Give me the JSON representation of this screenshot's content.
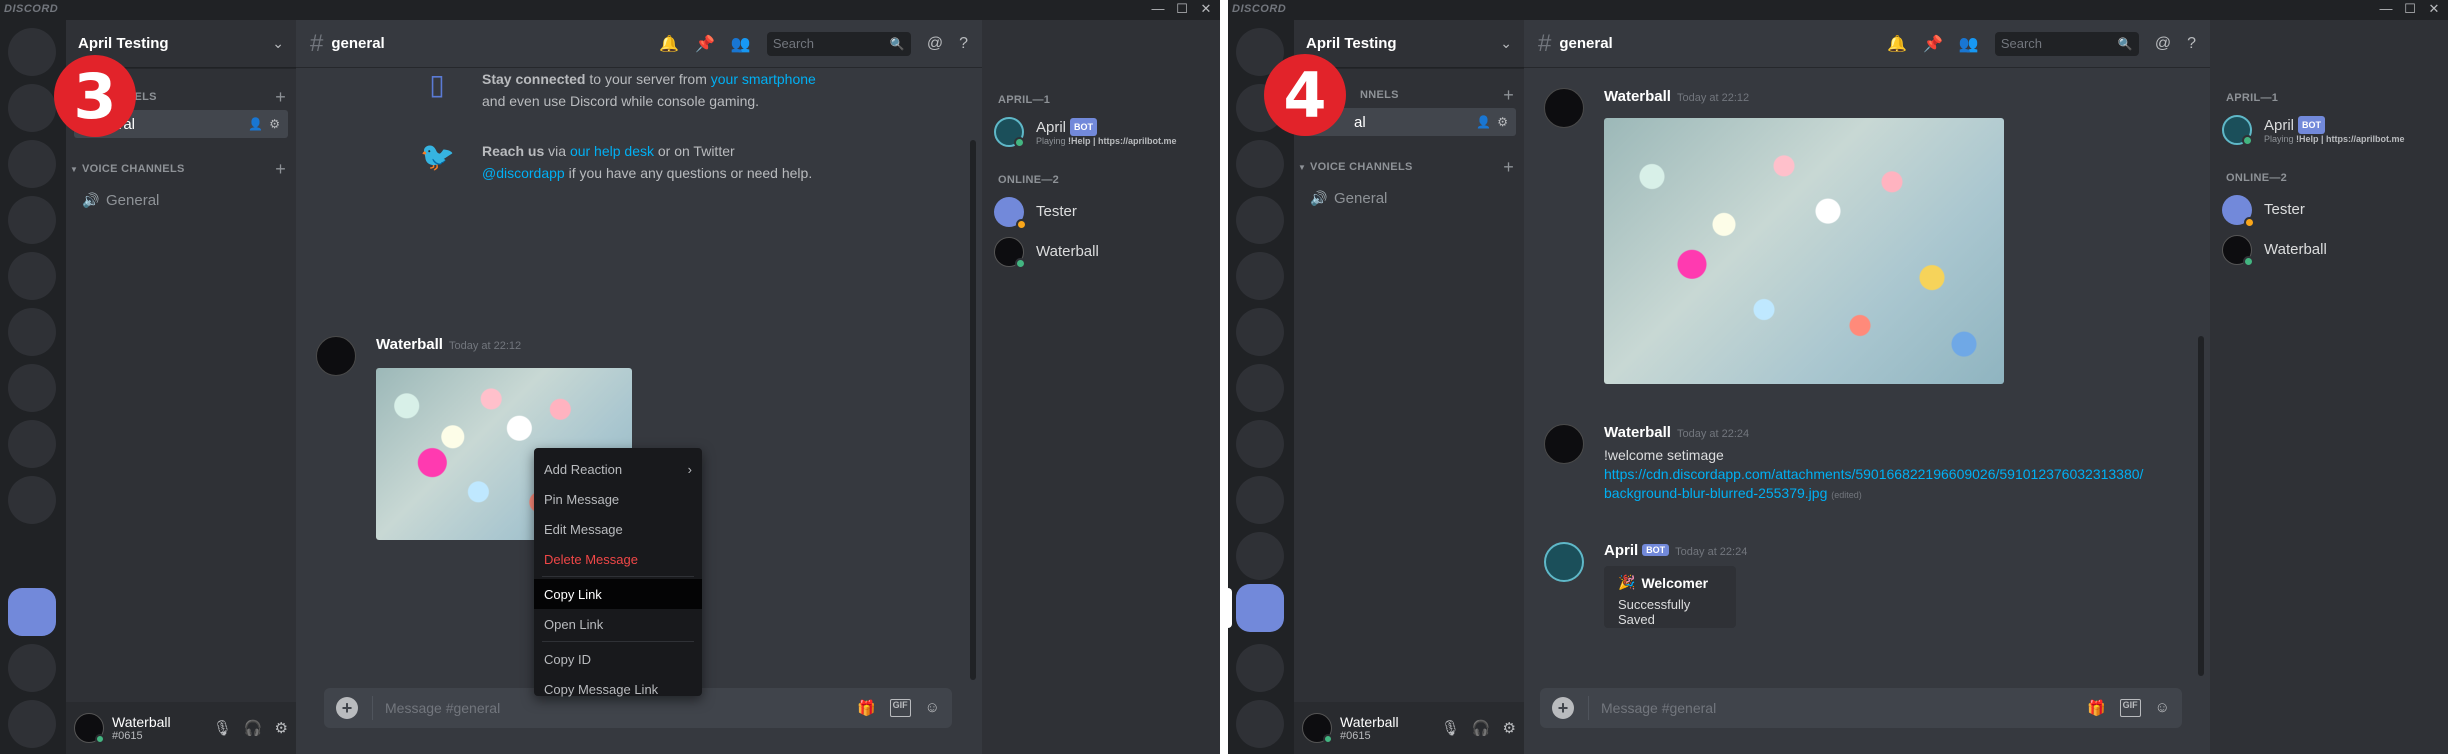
{
  "app": {
    "wordmark": "DISCORD",
    "win_min": "—",
    "win_max": "☐",
    "win_close": "✕"
  },
  "panels": [
    {
      "step": "3",
      "server_name": "April Testing",
      "text_category": "TEXT CHANNELS",
      "text_category_visible": "NNELS",
      "selected_channel": "general",
      "selected_channel_visible": "eral",
      "voice_category": "VOICE CHANNELS",
      "voice_channel": "General",
      "user": {
        "name": "Waterball",
        "discriminator": "#0615"
      },
      "header": {
        "channel": "general",
        "search_placeholder": "Search"
      },
      "welcome": {
        "stay_bold": "Stay connected",
        "stay_rest": " to your server from ",
        "stay_link": "your smartphone",
        "stay_line2": "and even use Discord while console gaming.",
        "reach_bold": "Reach us",
        "reach_via": " via ",
        "reach_link": "our help desk",
        "reach_rest": " or on Twitter",
        "twitter_link": "@discordapp",
        "twitter_rest": " if you have any questions or need help."
      },
      "message": {
        "author": "Waterball",
        "time": "Today at 22:12"
      },
      "context_menu": [
        {
          "label": "Add Reaction",
          "arrow": "›"
        },
        {
          "label": "Pin Message"
        },
        {
          "label": "Edit Message"
        },
        {
          "label": "Delete Message"
        },
        {
          "label": "Copy Link"
        },
        {
          "label": "Open Link"
        },
        {
          "label": "Copy ID"
        },
        {
          "label": "Copy Message Link"
        }
      ],
      "composer_placeholder": "Message #general",
      "members": {
        "cat1": "APRIL—1",
        "cat2": "ONLINE—2",
        "april": {
          "name": "April",
          "badge": "BOT",
          "playing_prefix": "Playing ",
          "playing": "!Help | https://aprilbot.me"
        },
        "tester": "Tester",
        "waterball": "Waterball"
      }
    },
    {
      "step": "4",
      "server_name": "April Testing",
      "text_category_visible": "NNELS",
      "selected_channel_visible": "al",
      "voice_category": "VOICE CHANNELS",
      "voice_channel": "General",
      "user": {
        "name": "Waterball",
        "discriminator": "#0615"
      },
      "header": {
        "channel": "general",
        "search_placeholder": "Search"
      },
      "messages": [
        {
          "author": "Waterball",
          "time": "Today at 22:12"
        },
        {
          "author": "Waterball",
          "time": "Today at 22:24",
          "text": "!welcome setimage",
          "link1": "https://cdn.discordapp.com/attachments/590166822196609026/591012376032313380/",
          "link2": "background-blur-blurred-255379.jpg",
          "edited": "(edited)"
        },
        {
          "author": "April",
          "badge": "BOT",
          "time": "Today at 22:24",
          "embed_title": "Welcomer",
          "embed_icon": "🎉",
          "embed_desc": "Successfully Saved"
        }
      ],
      "composer_placeholder": "Message #general",
      "members": {
        "cat1": "APRIL—1",
        "cat2": "ONLINE—2",
        "april": {
          "name": "April",
          "badge": "BOT",
          "playing_prefix": "Playing ",
          "playing": "!Help | https://aprilbot.me"
        },
        "tester": "Tester",
        "waterball": "Waterball"
      }
    }
  ],
  "icons": [
    "bell-icon",
    "pin-icon",
    "members-icon",
    "search-icon",
    "mention-icon",
    "help-icon",
    "mic-icon",
    "headphones-icon",
    "gear-icon",
    "gift-icon",
    "gif-icon",
    "emoji-icon"
  ],
  "colors": {
    "accent": "#7289da",
    "link": "#00b0f4",
    "danger": "#f04747",
    "online": "#43b581",
    "idle": "#faa61a",
    "step_badge": "#e2232a"
  }
}
